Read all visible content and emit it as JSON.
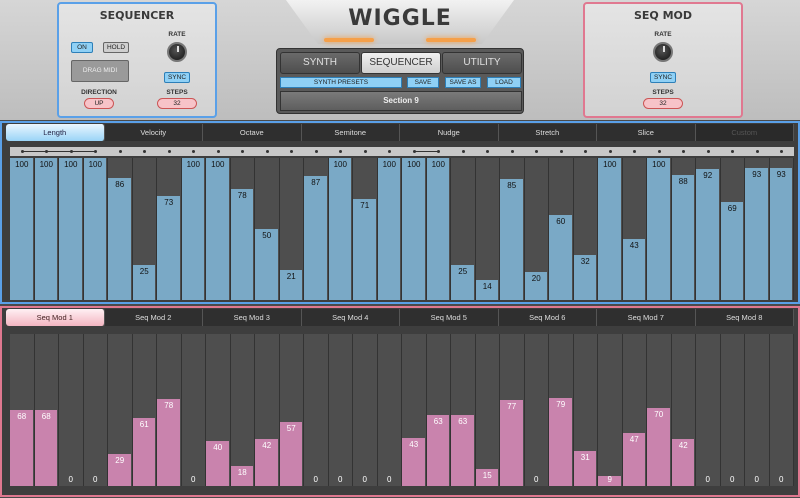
{
  "app": {
    "title": "WIGGLE"
  },
  "sequencer_panel": {
    "title": "SEQUENCER",
    "on": "ON",
    "hold": "HOLD",
    "drag_midi": "DRAG MIDI",
    "rate_label": "RATE",
    "sync": "SYNC",
    "direction_label": "DIRECTION",
    "direction_value": "UP",
    "steps_label": "STEPS",
    "steps_value": "32"
  },
  "seqmod_panel": {
    "title": "SEQ MOD",
    "rate_label": "RATE",
    "sync": "SYNC",
    "steps_label": "STEPS",
    "steps_value": "32"
  },
  "nav": {
    "tabs": [
      "SYNTH",
      "SEQUENCER",
      "UTILITY"
    ],
    "selected": "SEQUENCER",
    "synth_presets": "SYNTH PRESETS",
    "save": "SAVE",
    "save_as": "SAVE AS",
    "load": "LOAD",
    "section": "Section 9"
  },
  "sequencer": {
    "tabs": [
      "Length",
      "Velocity",
      "Octave",
      "Semitone",
      "Nudge",
      "Stretch",
      "Slice",
      "Custom"
    ],
    "selected": "Length",
    "values": [
      100,
      100,
      100,
      100,
      86,
      25,
      73,
      100,
      100,
      78,
      50,
      21,
      87,
      100,
      71,
      100,
      100,
      100,
      25,
      14,
      85,
      20,
      60,
      32,
      100,
      43,
      100,
      88,
      92,
      69,
      93,
      93
    ],
    "ties": [
      [
        0,
        3
      ],
      [
        16,
        17
      ]
    ]
  },
  "seqmod": {
    "tabs": [
      "Seq Mod 1",
      "Seq Mod 2",
      "Seq Mod 3",
      "Seq Mod 4",
      "Seq Mod 5",
      "Seq Mod 6",
      "Seq Mod 7",
      "Seq Mod 8"
    ],
    "selected": "Seq Mod 1",
    "values": [
      68,
      68,
      0,
      0,
      29,
      61,
      78,
      0,
      40,
      18,
      42,
      57,
      0,
      0,
      0,
      0,
      43,
      63,
      63,
      15,
      77,
      0,
      79,
      31,
      9,
      47,
      70,
      42,
      0,
      0,
      0,
      0
    ]
  },
  "colors": {
    "sequencer_accent": "#5aa0e8",
    "seqmod_accent": "#e07890",
    "seq_bar": "#7aa9c6",
    "mod_bar": "#c983ad"
  }
}
